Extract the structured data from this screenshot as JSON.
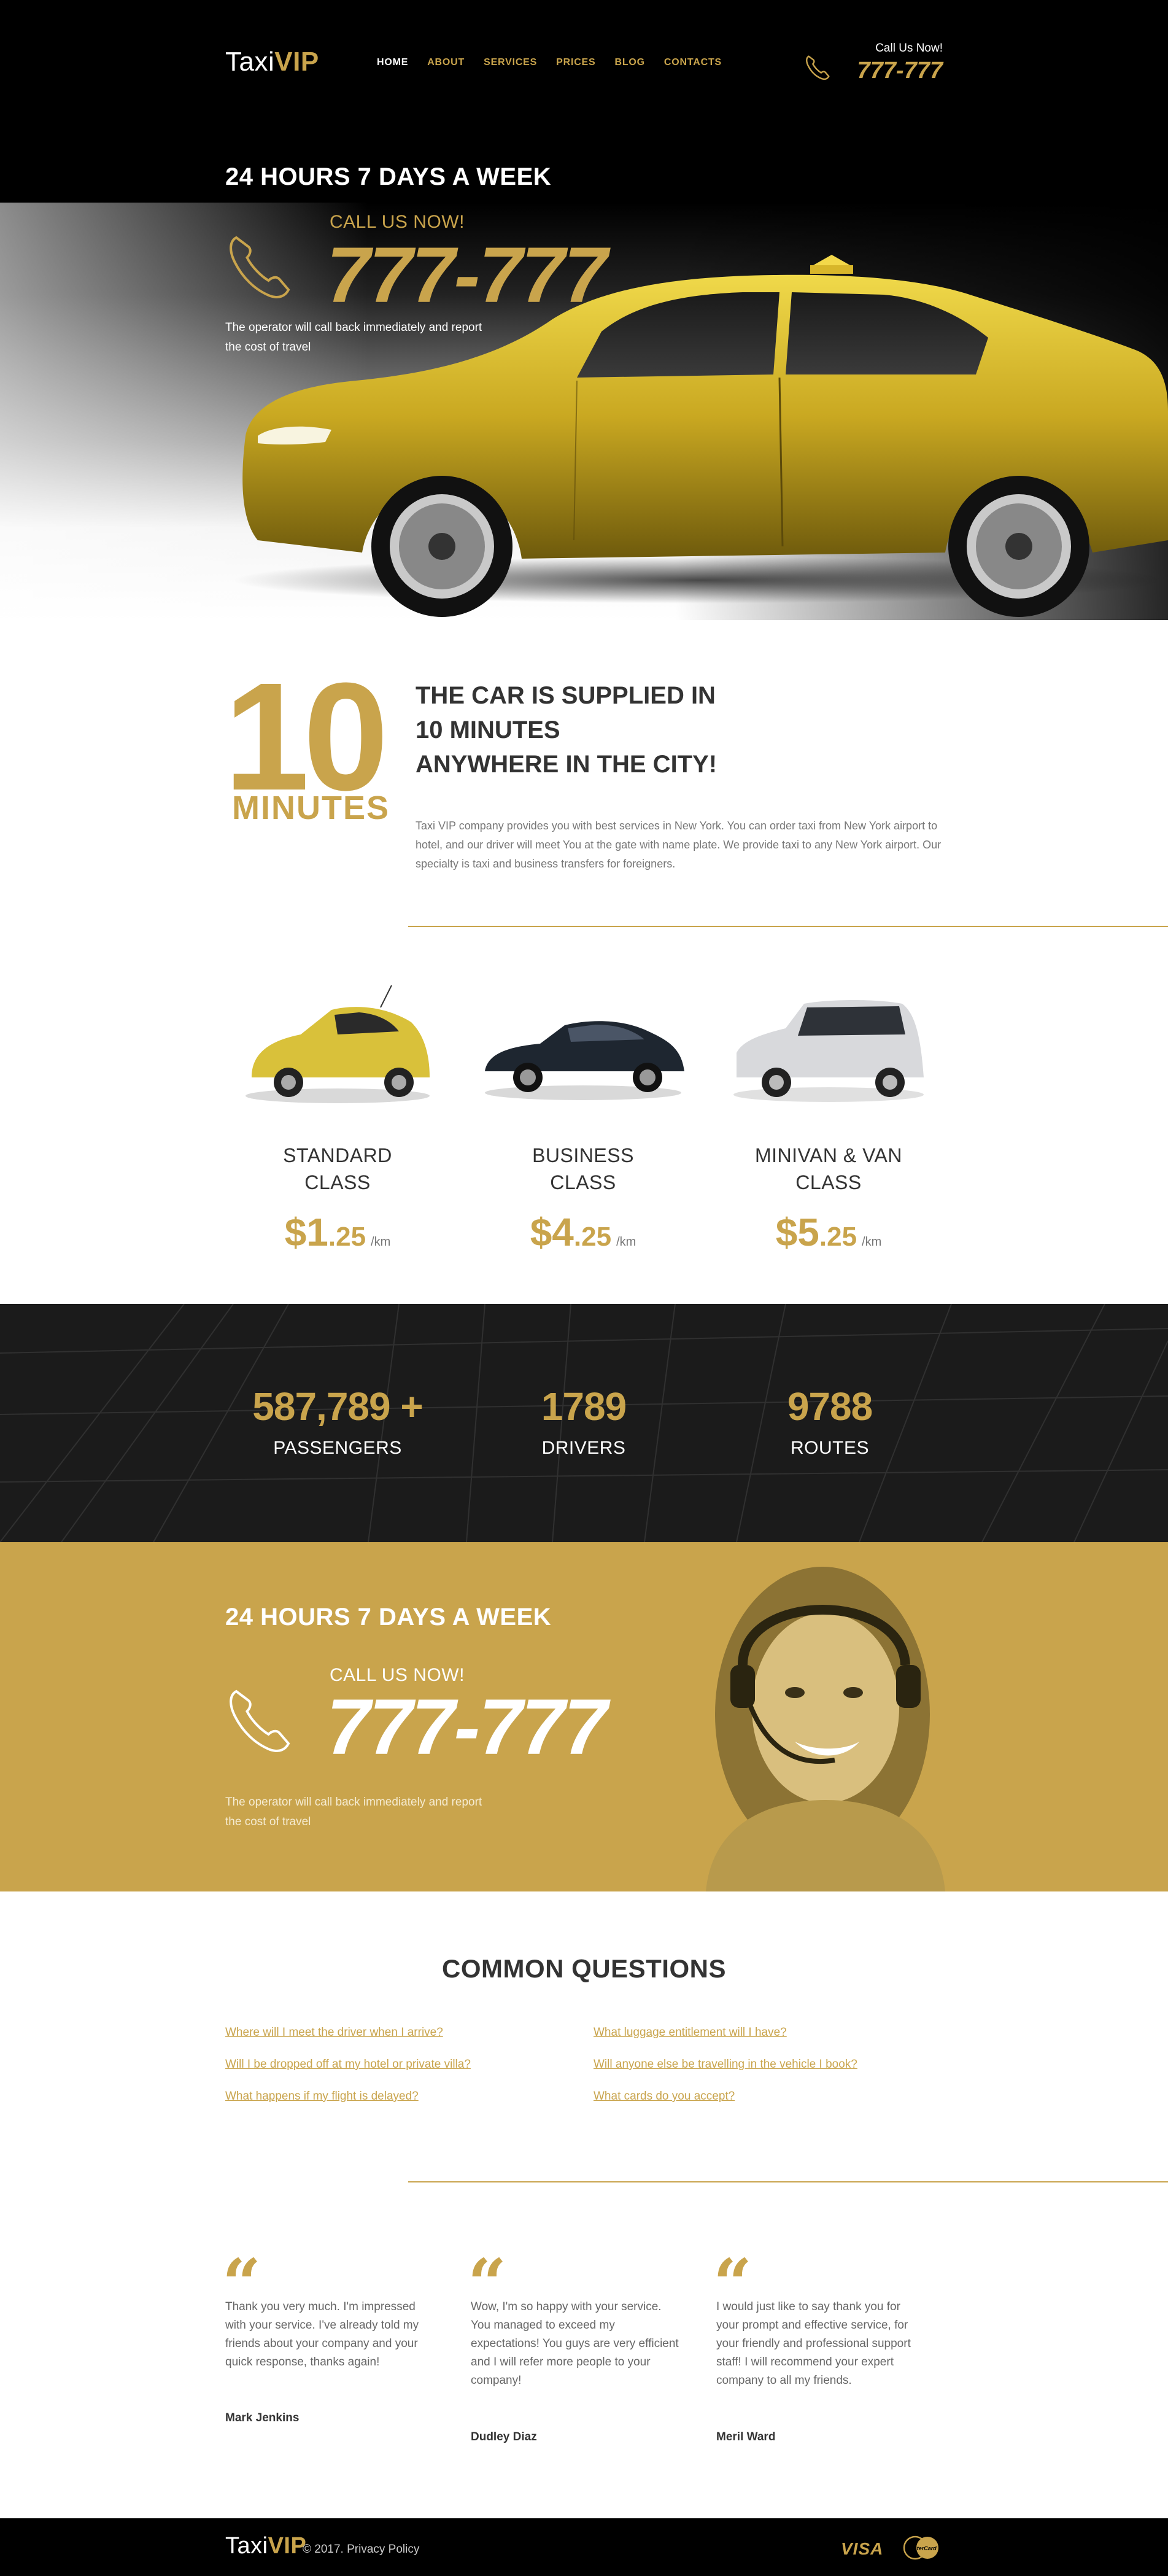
{
  "header": {
    "logo_main": "Taxi",
    "logo_accent": "VIP",
    "nav": [
      "HOME",
      "ABOUT",
      "SERVICES",
      "PRICES",
      "BLOG",
      "CONTACTS"
    ],
    "call_label": "Call Us Now!",
    "call_number": "777-777"
  },
  "hero": {
    "headline": "24 HOURS 7 DAYS A WEEK",
    "call_label": "CALL US NOW!",
    "phone": "777-777",
    "desc_line1": "The operator will call back immediately and report",
    "desc_line2": "the cost of travel"
  },
  "supply": {
    "big_number": "10",
    "big_label": "MINUTES",
    "title_line1": "THE CAR IS SUPPLIED IN",
    "title_line2": "10 MINUTES",
    "title_line3": "ANYWHERE IN THE CITY!",
    "desc": "Taxi VIP company provides you with best services in New York. You can order taxi from New York airport to hotel, and our driver will meet You at the gate with name plate. We provide taxi to any New York airport. Our specialty is taxi and business transfers for foreigners."
  },
  "classes": [
    {
      "line1": "STANDARD",
      "line2": "CLASS",
      "price_main": "$1",
      "price_cents": ".25",
      "unit": "/km",
      "color": "#d9c13a"
    },
    {
      "line1": "BUSINESS",
      "line2": "CLASS",
      "price_main": "$4",
      "price_cents": ".25",
      "unit": "/km",
      "color": "#1e2630"
    },
    {
      "line1": "MINIVAN & VAN",
      "line2": "CLASS",
      "price_main": "$5",
      "price_cents": ".25",
      "unit": "/km",
      "color": "#d8d9dc"
    }
  ],
  "stats": [
    {
      "number": "587,789 +",
      "label": "PASSENGERS"
    },
    {
      "number": "1789",
      "label": "DRIVERS"
    },
    {
      "number": "9788",
      "label": "ROUTES"
    }
  ],
  "gold_call": {
    "headline": "24 HOURS 7 DAYS A WEEK",
    "call_label": "CALL US NOW!",
    "phone": "777-777",
    "desc_line1": "The operator will call back immediately and report",
    "desc_line2": "the cost of travel"
  },
  "faq": {
    "title": "COMMON QUESTIONS",
    "left": [
      "Where will I meet the driver when I arrive?",
      "Will I be dropped off at my hotel or private villa?",
      "What happens if my flight is delayed?"
    ],
    "right": [
      "What luggage entitlement will I have?",
      "Will anyone else be travelling in the vehicle I book?",
      "What cards do you accept?"
    ]
  },
  "testimonials": [
    {
      "lines": [
        "Thank you very much. I'm impressed",
        "with your service. I've already told my",
        "friends about your company and your",
        "quick response, thanks again!"
      ],
      "name": "Mark Jenkins"
    },
    {
      "lines": [
        "Wow, I'm so happy with your service.",
        "You managed to exceed my",
        "expectations! You guys are very efficient",
        "and I will refer more people to your",
        "company!"
      ],
      "name": "Dudley Diaz"
    },
    {
      "lines": [
        "I would just like to say thank you for",
        "your prompt and effective service, for",
        "your friendly and professional support",
        "staff! I will recommend your expert",
        "company to all my friends."
      ],
      "name": "Meril Ward"
    }
  ],
  "footer": {
    "logo_main": "Taxi",
    "logo_accent": "VIP",
    "copyright": "© 2017.",
    "policy": "Privacy Policy",
    "visa": "VISA",
    "mastercard": "MasterCard"
  },
  "colors": {
    "accent": "#c9a44c",
    "dark": "#000000",
    "text": "#333333"
  }
}
